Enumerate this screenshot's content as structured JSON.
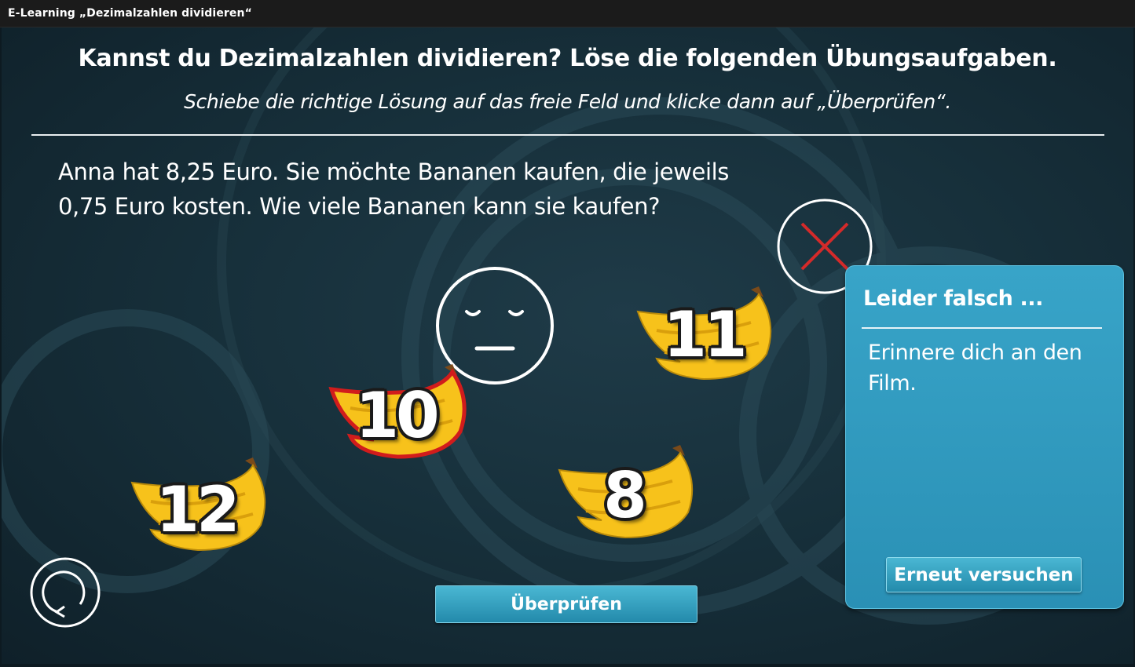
{
  "window": {
    "title": "E-Learning „Dezimalzahlen dividieren“"
  },
  "header": {
    "title": "Kannst du Dezimalzahlen dividieren? Löse die folgenden Übungsaufgaben.",
    "instruction": "Schiebe die richtige Lösung auf das freie Feld und klicke dann auf „Überprüfen“."
  },
  "question": {
    "line1": "Anna hat 8,25 Euro. Sie möchte Bananen kaufen, die jeweils",
    "line2": "0,75 Euro kosten. Wie viele Bananen kann sie kaufen?"
  },
  "answers": [
    {
      "label": "12",
      "selected": false
    },
    {
      "label": "10",
      "selected": true
    },
    {
      "label": "8",
      "selected": false
    },
    {
      "label": "11",
      "selected": false
    }
  ],
  "result_icon": "wrong-x-icon",
  "drop_target_icon": "neutral-face-icon",
  "buttons": {
    "check": "Überprüfen",
    "restart_icon": "restart-icon"
  },
  "feedback": {
    "title": "Leider falsch ...",
    "text": "Erinnere dich an den Film.",
    "retry": "Erneut versuchen"
  },
  "colors": {
    "accent": "#2f9cc0",
    "wrong": "#d42a2a",
    "banana": "#f7c21b",
    "selected_outline": "#d11c1c"
  }
}
